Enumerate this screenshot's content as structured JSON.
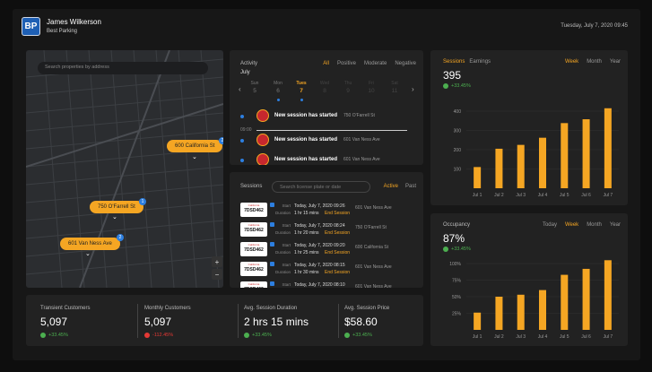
{
  "header": {
    "logo_text": "BP",
    "user_name": "James Wilkerson",
    "company": "Best Parking",
    "datetime": "Tuesday, July 7, 2020 09:45"
  },
  "map": {
    "search_placeholder": "Search properties by address",
    "pins": [
      {
        "label": "600 California St",
        "badge": "2"
      },
      {
        "label": "750 O'Farrell St",
        "badge": "1"
      },
      {
        "label": "601 Van Ness Ave",
        "badge": "2"
      }
    ],
    "zoom_in": "+",
    "zoom_out": "−"
  },
  "activity": {
    "title": "Activity",
    "filters": [
      "All",
      "Positive",
      "Moderate",
      "Negative"
    ],
    "active_filter": "All",
    "month": "July",
    "days": [
      {
        "name": "Sun",
        "num": "5",
        "state": "normal",
        "dot": false
      },
      {
        "name": "Mon",
        "num": "6",
        "state": "normal",
        "dot": true
      },
      {
        "name": "Tues",
        "num": "7",
        "state": "today",
        "dot": true
      },
      {
        "name": "Wed",
        "num": "8",
        "state": "dim",
        "dot": false
      },
      {
        "name": "Thu",
        "num": "9",
        "state": "dim",
        "dot": false
      },
      {
        "name": "Fri",
        "num": "10",
        "state": "dim",
        "dot": false
      },
      {
        "name": "Sat",
        "num": "11",
        "state": "dim",
        "dot": false
      }
    ],
    "time_marker": "09:00",
    "events": [
      {
        "text": "New session has started",
        "address": "750 O'Farrell St"
      },
      {
        "text": "New session has started",
        "address": "601 Van Ness Ave"
      },
      {
        "text": "New session has started",
        "address": "601 Van Ness Ave"
      }
    ]
  },
  "sessions": {
    "title": "Sessions",
    "search_placeholder": "Search license plate or date",
    "tabs": [
      "Active",
      "Past"
    ],
    "start_label": "Start",
    "duration_label": "Duration",
    "end_label": "End Session",
    "rows": [
      {
        "plate": "7DSD462",
        "start": "Today, July 7, 2020 09:26",
        "duration": "1 hr 15 mins",
        "address": "601 Van Ness Ave"
      },
      {
        "plate": "7DSD462",
        "start": "Today, July 7, 2020 08:24",
        "duration": "1 hr 20 mins",
        "address": "750 O'Farrell St"
      },
      {
        "plate": "7DSD462",
        "start": "Today, July 7, 2020 09:20",
        "duration": "1 hr 25 mins",
        "address": "600 California St"
      },
      {
        "plate": "7DSD462",
        "start": "Today, July 7, 2020 08:15",
        "duration": "1 hr 30 mins",
        "address": "601 Van Ness Ave"
      },
      {
        "plate": "7DSD462",
        "start": "Today, July 7, 2020 08:10",
        "duration": "1 hr 35 mins",
        "address": "601 Van Ness Ave"
      }
    ]
  },
  "stats": [
    {
      "label": "Transient Customers",
      "value": "5,097",
      "change": "+33.45%",
      "dir": "up"
    },
    {
      "label": "Monthly Customers",
      "value": "5,097",
      "change": "-112.45%",
      "dir": "down"
    },
    {
      "label": "Avg. Session Duration",
      "value": "2 hrs 15 mins",
      "change": "+33.45%",
      "dir": "up"
    },
    {
      "label": "Avg. Session Price",
      "value": "$58.60",
      "change": "+33.45%",
      "dir": "up"
    }
  ],
  "sessions_chart": {
    "tabs_left": [
      "Sessions",
      "Earnings"
    ],
    "tabs_right": [
      "Week",
      "Month",
      "Year"
    ],
    "active_right": "Week",
    "value": "395",
    "change": "+33.45%"
  },
  "occupancy_chart": {
    "title": "Occupancy",
    "tabs_right": [
      "Today",
      "Week",
      "Month",
      "Year"
    ],
    "active_right": "Week",
    "value": "87%",
    "change": "+33.45%"
  },
  "colors": {
    "accent": "#f5a623",
    "blue": "#2d7fe0",
    "green": "#4caf50",
    "red": "#e53935"
  },
  "chart_data": [
    {
      "type": "bar",
      "categories": [
        "Jul 1",
        "Jul 2",
        "Jul 3",
        "Jul 4",
        "Jul 5",
        "Jul 6",
        "Jul 7"
      ],
      "values": [
        110,
        205,
        225,
        262,
        338,
        358,
        415
      ],
      "ylim": [
        0,
        400
      ],
      "yticks": [
        "100",
        "200",
        "300",
        "400"
      ],
      "xlabel": "",
      "ylabel": ""
    },
    {
      "type": "bar",
      "categories": [
        "Jul 1",
        "Jul 2",
        "Jul 3",
        "Jul 4",
        "Jul 5",
        "Jul 6",
        "Jul 7"
      ],
      "values": [
        26,
        50,
        53,
        60,
        83,
        92,
        105
      ],
      "ylim": [
        0,
        100
      ],
      "yticks": [
        "25%",
        "50%",
        "75%",
        "100%"
      ],
      "xlabel": "",
      "ylabel": ""
    }
  ]
}
